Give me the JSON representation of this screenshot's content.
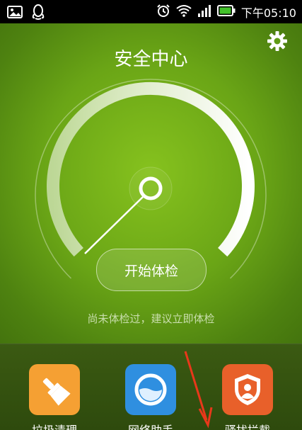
{
  "status_bar": {
    "time": "下午05:10",
    "left_icons": [
      "gallery-notification-icon",
      "qq-notification-icon"
    ],
    "right_icons": [
      "alarm-icon",
      "wifi-icon",
      "signal-icon",
      "battery-icon"
    ]
  },
  "header": {
    "title": "安全中心",
    "settings_icon": "gear-icon"
  },
  "gauge": {
    "level": 0.0,
    "needle": "pointing to start"
  },
  "main": {
    "start_button": "开始体检",
    "hint": "尚未体检过，建议立即体检"
  },
  "tools": [
    {
      "label": "垃圾清理",
      "icon": "broom-icon",
      "color": "#f5a033"
    },
    {
      "label": "网络助手",
      "icon": "network-icon",
      "color": "#2f8fe0"
    },
    {
      "label": "骚扰拦截",
      "icon": "shield-user-icon",
      "color": "#e8602a"
    }
  ],
  "colors": {
    "background_green": "#6aa516",
    "accent_white": "#ffffff"
  }
}
